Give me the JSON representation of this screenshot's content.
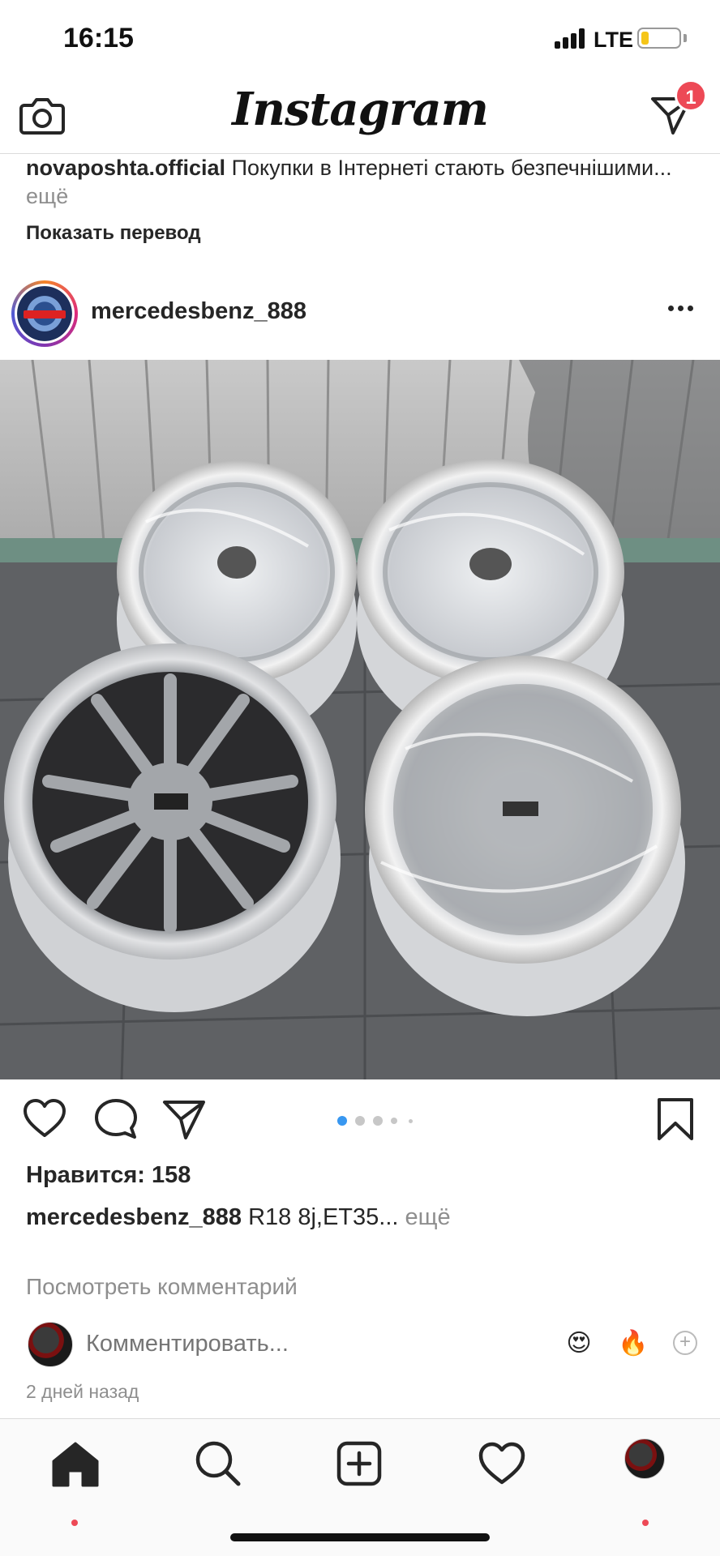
{
  "status_bar": {
    "time": "16:15",
    "network": "LTE"
  },
  "header": {
    "title": "Instagram",
    "camera_icon": "camera-icon",
    "direct_icon": "paper-plane-icon",
    "direct_badge": "1"
  },
  "previous_post": {
    "username": "novaposhta.official",
    "caption": "Покупки в Інтернеті стають безпечнішими...",
    "more": "ещё",
    "show_translation": "Показать перевод"
  },
  "post": {
    "username": "mercedesbenz_888",
    "more_icon": "more-horizontal-icon",
    "carousel": {
      "count": 5,
      "active": 0
    },
    "likes": "Нравится: 158",
    "caption_username": "mercedesbenz_888",
    "caption_text": "R18 8j,ET35...",
    "caption_more": "ещё",
    "view_comments": "Посмотреть комментарий",
    "comment_placeholder": "Комментировать...",
    "quick_emojis": [
      "😍",
      "🔥"
    ],
    "timestamp": "2 дней назад"
  },
  "tabs": [
    {
      "name": "home",
      "icon": "home-icon"
    },
    {
      "name": "search",
      "icon": "search-icon"
    },
    {
      "name": "new-post",
      "icon": "add-post-icon"
    },
    {
      "name": "activity",
      "icon": "heart-icon"
    },
    {
      "name": "profile",
      "icon": "profile-avatar"
    }
  ],
  "colors": {
    "accent": "#3897f0",
    "badge": "#ed4956",
    "muted": "#8e8e8e",
    "text": "#262626"
  }
}
